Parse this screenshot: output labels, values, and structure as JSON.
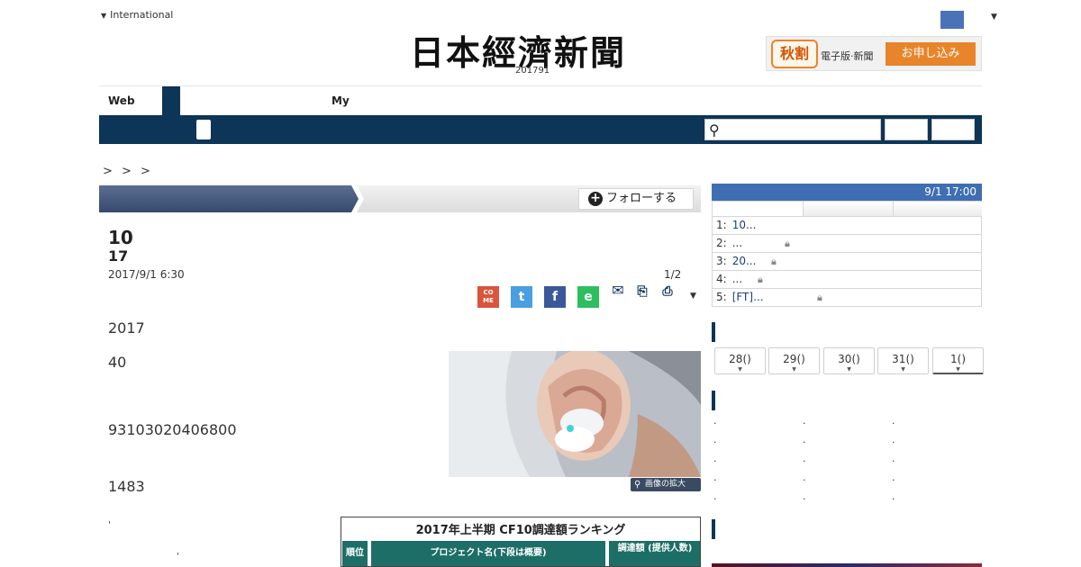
{
  "header": {
    "international_label": "International",
    "logo_text": "日本經濟新聞",
    "edition": "201791",
    "promo": {
      "badge": "秋割",
      "text": "電子版·新聞",
      "button": "お申し込み"
    }
  },
  "tabs": {
    "web": "Web",
    "my": "My"
  },
  "breadcrumb": "> > >",
  "section": {
    "follow_label": "フォローする"
  },
  "article": {
    "headline_line1": "10",
    "headline_line2": "17",
    "date": "2017/9/1 6:30",
    "page_indicator": "1/2",
    "share": {
      "come": "CO ME",
      "twitter": "t",
      "facebook": "f",
      "evernote": "e",
      "mail": "✉",
      "clip": "⎘",
      "print": "⎙",
      "more": "▼"
    },
    "paragraphs": [
      "2017",
      "40",
      "93103020406800",
      "1483"
    ],
    "photo_zoom": "画像の拡大",
    "table": {
      "title": "2017年上半期 CF10調達額ランキング",
      "headers": [
        "順位",
        "プロジェクト名(下段は概要)",
        "調達額 (提供人数)"
      ]
    },
    "fragments": [
      "'",
      "'"
    ]
  },
  "sidebar": {
    "ranking": {
      "time": "9/1 17:00",
      "rows": [
        {
          "n": "1:",
          "title": "10...",
          "locked": false
        },
        {
          "n": "2:",
          "title": "...",
          "locked": true
        },
        {
          "n": "3:",
          "title": "20...",
          "locked": true
        },
        {
          "n": "4:",
          "title": "...",
          "locked": true
        },
        {
          "n": "5:",
          "title": "[FT]...",
          "locked": true
        }
      ]
    },
    "date_tabs": [
      "28()",
      "29()",
      "30()",
      "31()",
      "1()"
    ],
    "bullets": [
      "·",
      "·",
      "·",
      "·",
      "·",
      "·",
      "·",
      "·",
      "·",
      "·",
      "·",
      "·",
      "·",
      "·",
      "·"
    ]
  },
  "icons": {
    "search": "search-icon",
    "lock": "lock-icon",
    "plus": "plus-circle-icon",
    "zoom": "magnifier-icon"
  }
}
